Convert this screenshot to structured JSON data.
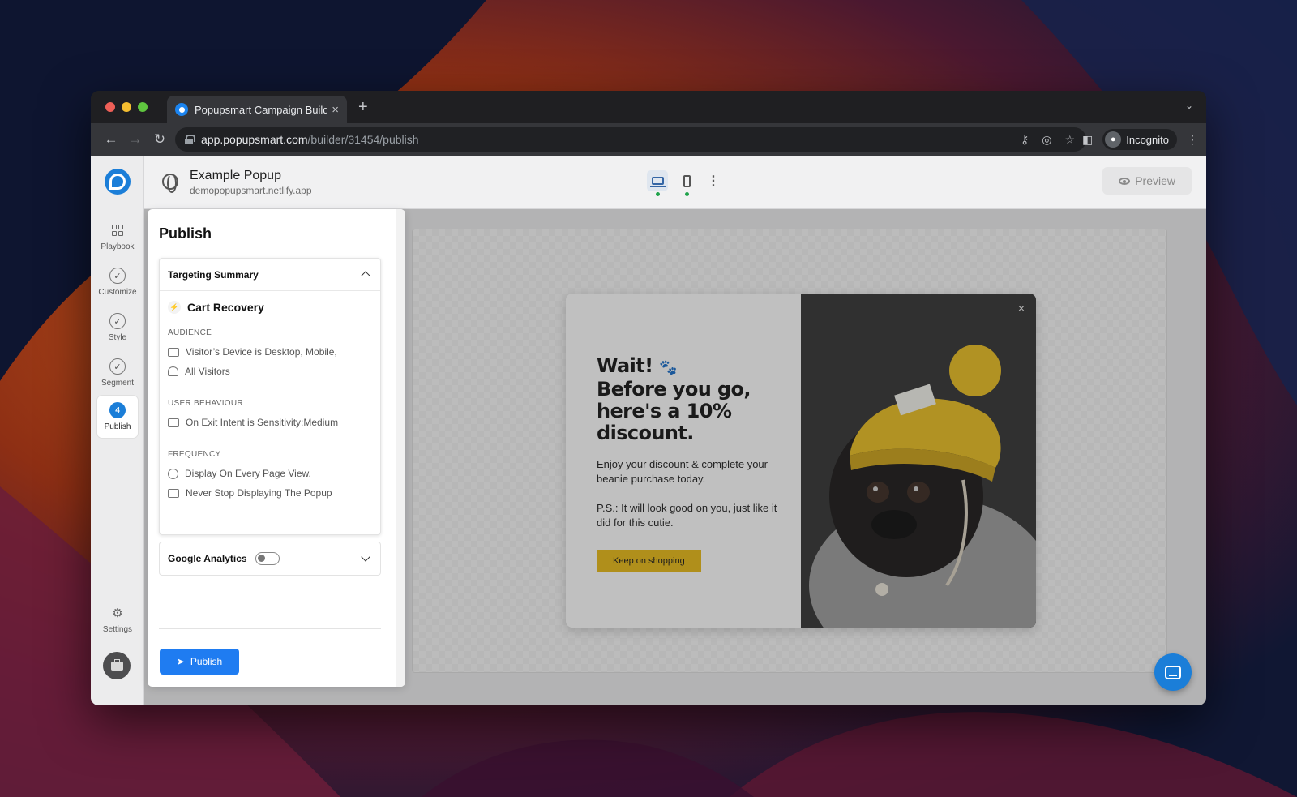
{
  "browser": {
    "tab_title": "Popupsmart Campaign Builder",
    "tab_close": "×",
    "new_tab": "+",
    "url_host": "app.popupsmart.com",
    "url_path": "/builder/31454/publish",
    "profile_label": "Incognito"
  },
  "header": {
    "project_title": "Example Popup",
    "project_domain": "demopopupsmart.netlify.app",
    "preview_label": "Preview"
  },
  "sidebar": {
    "items": [
      {
        "label": "Playbook"
      },
      {
        "label": "Customize"
      },
      {
        "label": "Style"
      },
      {
        "label": "Segment"
      },
      {
        "label": "Publish",
        "step": "4"
      }
    ],
    "settings_label": "Settings"
  },
  "publish_panel": {
    "title": "Publish",
    "targeting_summary_label": "Targeting Summary",
    "scenario_name": "Cart Recovery",
    "audience_label": "AUDIENCE",
    "audience_rules": [
      "Visitor’s Device is Desktop, Mobile,",
      "All Visitors"
    ],
    "behaviour_label": "USER BEHAVIOUR",
    "behaviour_rules": [
      "On Exit Intent is Sensitivity:Medium"
    ],
    "frequency_label": "FREQUENCY",
    "frequency_rules": [
      "Display On Every Page View.",
      "Never Stop Displaying The Popup"
    ],
    "google_analytics_label": "Google Analytics",
    "google_analytics_enabled": false,
    "publish_button": "Publish"
  },
  "popup": {
    "headline_line1": "Wait!",
    "headline_rest": "Before you go, here's a 10% discount.",
    "body": "Enjoy your discount & complete your beanie purchase today.",
    "ps": "P.S.: It will look good on you, just like it did for this cutie.",
    "cta": "Keep on shopping",
    "close": "×",
    "accent_color": "#e5b717"
  },
  "colors": {
    "primary": "#1f7cf1"
  }
}
